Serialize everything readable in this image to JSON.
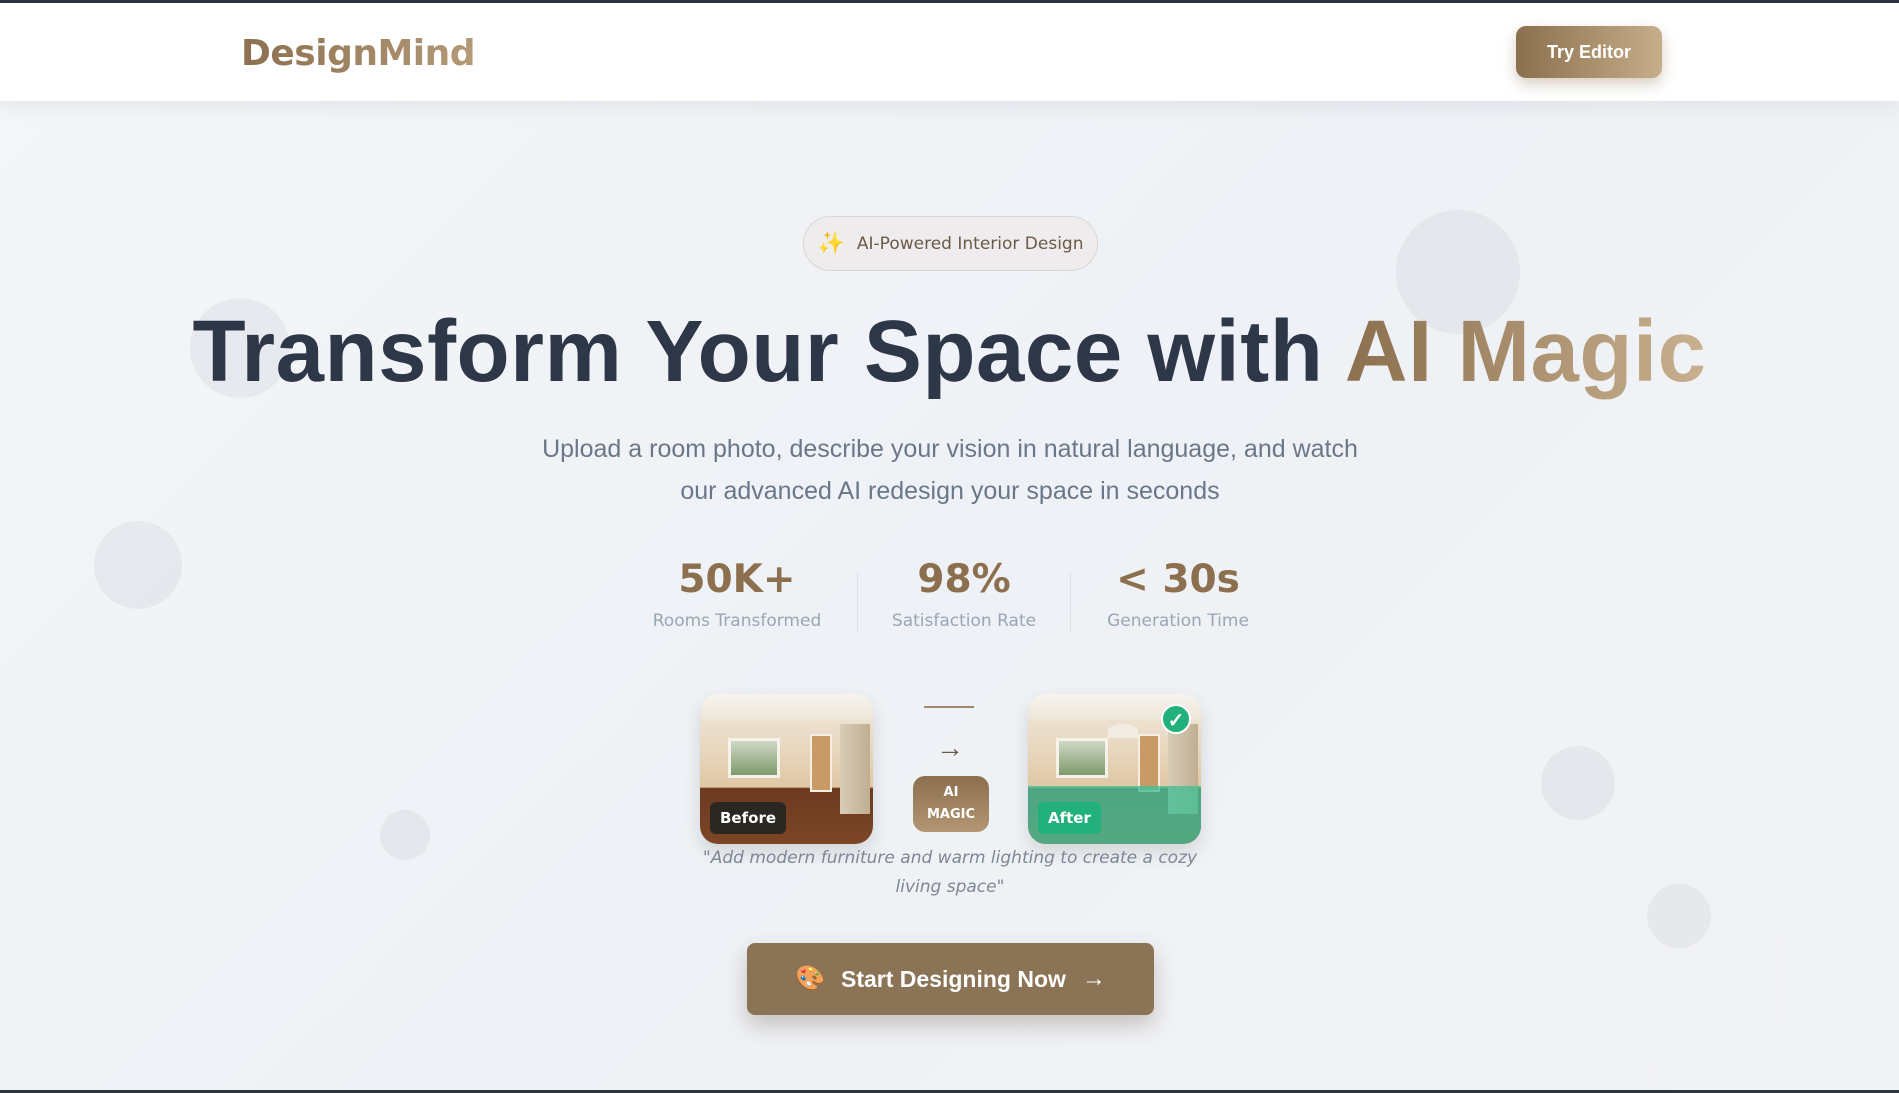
{
  "brand": {
    "name": "DesignMind"
  },
  "nav": {
    "try_label": "Try Editor"
  },
  "hero": {
    "badge_icon": "sparkles-icon",
    "badge_label": "AI-Powered Interior Design",
    "title_main": "Transform Your Space with",
    "title_accent": "AI Magic",
    "subtitle": "Upload a room photo, describe your vision in natural language, and watch our advanced AI redesign your space in seconds"
  },
  "stats": [
    {
      "value": "50K+",
      "label": "Rooms Transformed"
    },
    {
      "value": "98%",
      "label": "Satisfaction Rate"
    },
    {
      "value": "< 30s",
      "label": "Generation Time"
    }
  ],
  "demo": {
    "before_label": "Before",
    "after_label": "After",
    "arrow": "→",
    "ai_label_line1": "AI",
    "ai_label_line2": "MAGIC",
    "check": "✓",
    "prompt": "\"Add modern furniture and warm lighting to create a cozy living space\""
  },
  "cta": {
    "icon": "palette-icon",
    "label": "Start Designing Now",
    "arrow": "→"
  },
  "colors": {
    "accent": "#8b6f4e",
    "heading": "#2d3748",
    "success": "#22b07d"
  }
}
